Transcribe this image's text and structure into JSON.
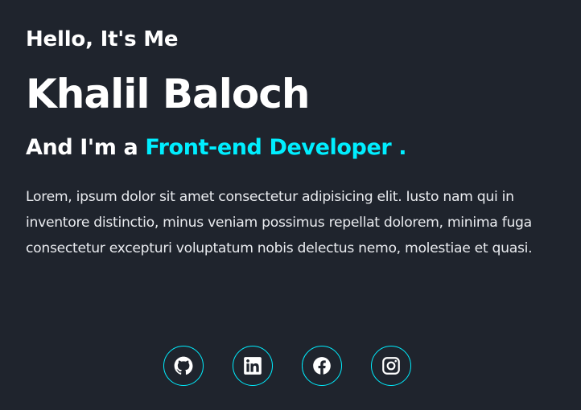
{
  "hero": {
    "greeting": "Hello, It's Me",
    "name": "Khalil Baloch",
    "role_prefix": "And I'm a",
    "role_highlight": "Front-end Developer .",
    "description": "Lorem, ipsum dolor sit amet consectetur adipisicing elit. Iusto nam qui in inventore distinctio, minus veniam possimus repellat dolorem, minima fuga consectetur excepturi voluptatum nobis delectus nemo, molestiae et quasi."
  },
  "socials": [
    {
      "icon": "github-icon"
    },
    {
      "icon": "linkedin-icon"
    },
    {
      "icon": "facebook-icon"
    },
    {
      "icon": "instagram-icon"
    }
  ],
  "colors": {
    "background": "#1f242d",
    "accent": "#00eeff",
    "text": "#ffffff"
  }
}
